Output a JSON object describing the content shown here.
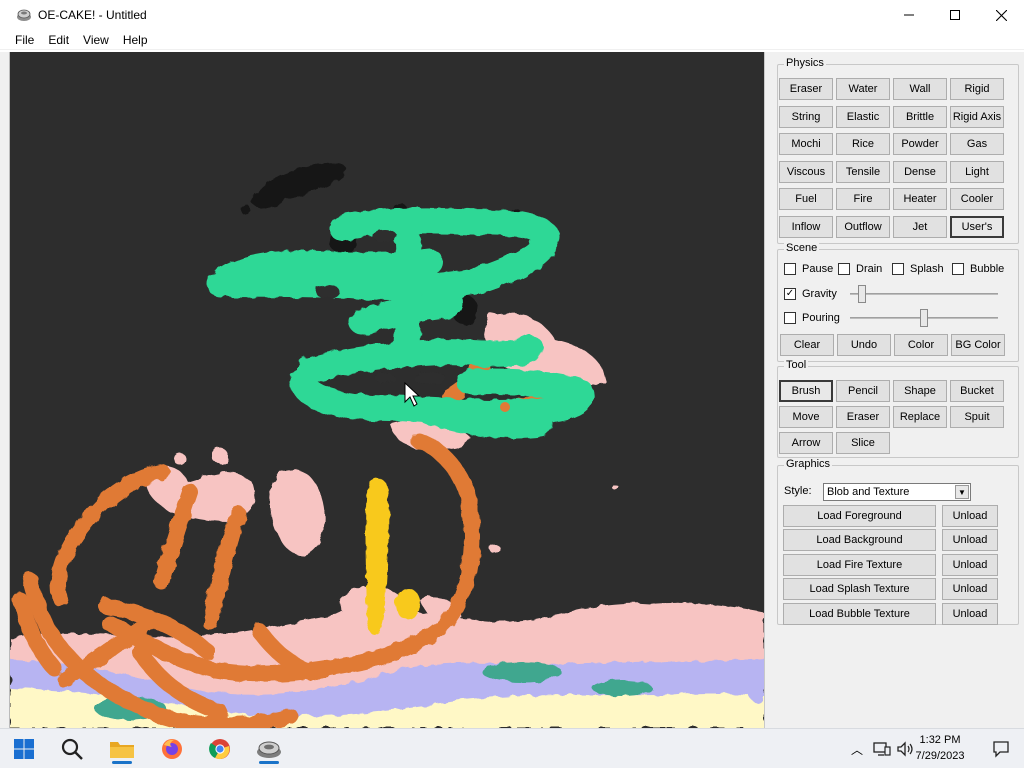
{
  "window": {
    "title": "OE-CAKE! - Untitled",
    "controls": {
      "minimize": "minimize-icon",
      "maximize": "maximize-icon",
      "close": "close-icon"
    }
  },
  "menu": [
    "File",
    "Edit",
    "View",
    "Help"
  ],
  "physics": {
    "title": "Physics",
    "buttons": [
      "Eraser",
      "Water",
      "Wall",
      "Rigid",
      "String",
      "Elastic",
      "Brittle",
      "Rigid Axis",
      "Mochi",
      "Rice",
      "Powder",
      "Gas",
      "Viscous",
      "Tensile",
      "Dense",
      "Light",
      "Fuel",
      "Fire",
      "Heater",
      "Cooler",
      "Inflow",
      "Outflow",
      "Jet",
      "User's"
    ],
    "selected": "User's"
  },
  "scene": {
    "title": "Scene",
    "checks": [
      {
        "label": "Pause",
        "checked": false
      },
      {
        "label": "Drain",
        "checked": false
      },
      {
        "label": "Splash",
        "checked": false
      },
      {
        "label": "Bubble",
        "checked": false
      }
    ],
    "gravity": {
      "label": "Gravity",
      "checked": true,
      "level": 0.08
    },
    "pouring": {
      "label": "Pouring",
      "checked": false,
      "level": 0.5
    },
    "buttons": [
      "Clear",
      "Undo",
      "Color",
      "BG Color"
    ]
  },
  "tool": {
    "title": "Tool",
    "buttons": [
      "Brush",
      "Pencil",
      "Shape",
      "Bucket",
      "Move",
      "Eraser",
      "Replace",
      "Spuit",
      "Arrow",
      "Slice"
    ],
    "selected": "Brush"
  },
  "graphics": {
    "title": "Graphics",
    "style_label": "Style:",
    "style_value": "Blob and Texture",
    "rows": [
      {
        "load": "Load Foreground",
        "unload": "Unload"
      },
      {
        "load": "Load Background",
        "unload": "Unload"
      },
      {
        "load": "Load Fire Texture",
        "unload": "Unload"
      },
      {
        "load": "Load Splash Texture",
        "unload": "Unload"
      },
      {
        "load": "Load Bubble Texture",
        "unload": "Unload"
      }
    ]
  },
  "colors": {
    "canvas_bg": "#2d2d2d",
    "green": "#2fd896",
    "orange": "#e07a36",
    "pink": "#f7c4c2",
    "yellow": "#f8c91a",
    "cream": "#fff8c6",
    "lavender": "#b7b4f2",
    "teal": "#3fa78f"
  },
  "taskbar": {
    "icons": [
      "windows-start-icon",
      "search-icon",
      "file-explorer-icon",
      "firefox-icon",
      "chrome-icon",
      "oe-cake-icon"
    ],
    "time": "1:32 PM",
    "date": "7/29/2023"
  }
}
